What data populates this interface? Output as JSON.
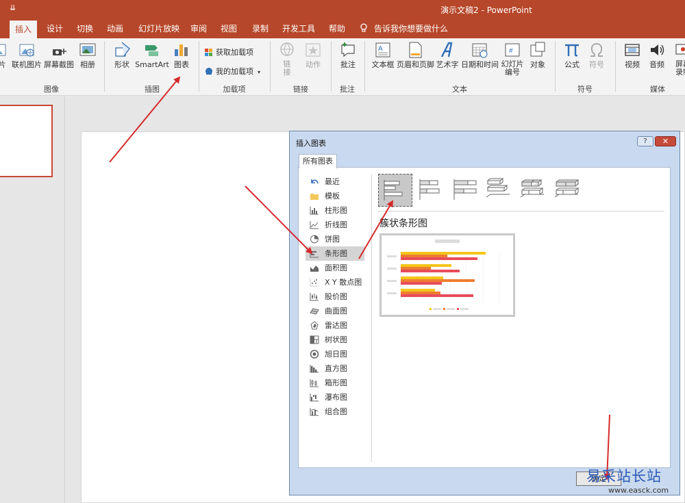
{
  "window": {
    "title": "演示文稿2  -  PowerPoint",
    "qat_glyph": "⇊"
  },
  "tabs": [
    {
      "label": "插入",
      "active": true
    },
    {
      "label": "设计"
    },
    {
      "label": "切换"
    },
    {
      "label": "动画"
    },
    {
      "label": "幻灯片放映"
    },
    {
      "label": "审阅"
    },
    {
      "label": "视图"
    },
    {
      "label": "录制"
    },
    {
      "label": "开发工具"
    },
    {
      "label": "帮助"
    }
  ],
  "tell_me": "告诉我你想要做什么",
  "ribbon": {
    "images": {
      "label": "图像",
      "buttons": [
        "片",
        "联机图片",
        "屏幕截图",
        "相册"
      ]
    },
    "illustrations": {
      "label": "插图",
      "buttons": [
        "形状",
        "SmartArt",
        "图表"
      ]
    },
    "addins": {
      "label": "加载项",
      "get": "获取加载项",
      "mine": "我的加载项"
    },
    "links": {
      "label": "链接",
      "buttons": [
        "链\n接",
        "动作"
      ]
    },
    "comments": {
      "label": "批注",
      "buttons": [
        "批注"
      ]
    },
    "text": {
      "label": "文本",
      "buttons": [
        "文本框",
        "页眉和页脚",
        "艺术字",
        "日期和时间",
        "幻灯片\n编号",
        "对象"
      ]
    },
    "symbols": {
      "label": "符号",
      "buttons": [
        "公式",
        "符号"
      ]
    },
    "media": {
      "label": "媒体",
      "buttons": [
        "视频",
        "音频",
        "屏幕\n录制"
      ]
    }
  },
  "dialog": {
    "title": "插入图表",
    "help": "?",
    "close": "✕",
    "tab": "所有图表",
    "categories": [
      {
        "label": "最近",
        "icon": "undo-icon"
      },
      {
        "label": "模板",
        "icon": "folder-icon"
      },
      {
        "label": "柱形图",
        "icon": "column-chart-icon"
      },
      {
        "label": "折线图",
        "icon": "line-chart-icon"
      },
      {
        "label": "饼图",
        "icon": "pie-chart-icon"
      },
      {
        "label": "条形图",
        "icon": "bar-chart-icon",
        "selected": true
      },
      {
        "label": "面积图",
        "icon": "area-chart-icon"
      },
      {
        "label": "X Y 散点图",
        "icon": "scatter-chart-icon"
      },
      {
        "label": "股价图",
        "icon": "stock-chart-icon"
      },
      {
        "label": "曲面图",
        "icon": "surface-chart-icon"
      },
      {
        "label": "雷达图",
        "icon": "radar-chart-icon"
      },
      {
        "label": "树状图",
        "icon": "treemap-icon"
      },
      {
        "label": "旭日图",
        "icon": "sunburst-icon"
      },
      {
        "label": "直方图",
        "icon": "histogram-icon"
      },
      {
        "label": "箱形图",
        "icon": "box-plot-icon"
      },
      {
        "label": "瀑布图",
        "icon": "waterfall-icon"
      },
      {
        "label": "组合图",
        "icon": "combo-chart-icon"
      }
    ],
    "subtype_title": "簇状条形图",
    "ok_label": "确定"
  },
  "colors": {
    "accent": "#b7472a",
    "arrow": "#d62a2a",
    "preview_series": [
      "#f5c518",
      "#ed7d31",
      "#e84c5a"
    ]
  },
  "watermark": {
    "text": "易采站长站",
    "url": "www.easck.com"
  }
}
